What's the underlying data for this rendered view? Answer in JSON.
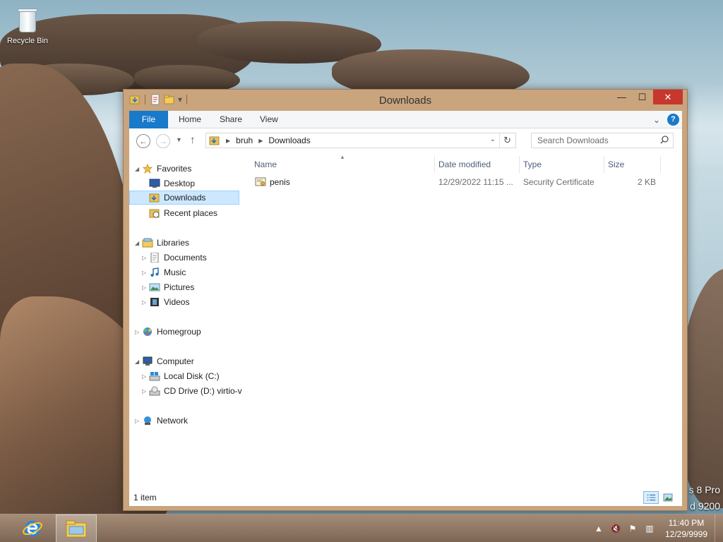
{
  "desktop": {
    "recycle_bin_label": "Recycle Bin",
    "watermark_line1": "s 8 Pro",
    "watermark_line2": "d 9200"
  },
  "window": {
    "title": "Downloads",
    "controls": {
      "minimize": "—",
      "maximize": "☐",
      "close": "✕"
    }
  },
  "ribbon": {
    "tabs": [
      "File",
      "Home",
      "Share",
      "View"
    ],
    "help": "?"
  },
  "address_bar": {
    "breadcrumbs": [
      "bruh",
      "Downloads"
    ]
  },
  "search": {
    "placeholder": "Search Downloads"
  },
  "nav_pane": {
    "favorites": {
      "label": "Favorites",
      "items": [
        "Desktop",
        "Downloads",
        "Recent places"
      ],
      "selected": "Downloads"
    },
    "libraries": {
      "label": "Libraries",
      "items": [
        "Documents",
        "Music",
        "Pictures",
        "Videos"
      ]
    },
    "homegroup": {
      "label": "Homegroup"
    },
    "computer": {
      "label": "Computer",
      "items": [
        "Local Disk (C:)",
        "CD Drive (D:) virtio-v"
      ]
    },
    "network": {
      "label": "Network"
    }
  },
  "file_list": {
    "columns": [
      "Name",
      "Date modified",
      "Type",
      "Size"
    ],
    "rows": [
      {
        "name": "penis",
        "date_modified": "12/29/2022 11:15 ...",
        "type": "Security Certificate",
        "size": "2 KB",
        "icon": "certificate-icon"
      }
    ]
  },
  "status_bar": {
    "item_count": "1 item"
  },
  "taskbar": {
    "pinned": [
      "internet-explorer-icon",
      "file-explorer-icon"
    ],
    "clock_time": "11:40 PM",
    "clock_date": "12/29/9999"
  },
  "colors": {
    "window_frame": "#c9a47d",
    "file_tab": "#1979ca",
    "selection": "#cce8ff",
    "close_button": "#c7372e"
  }
}
